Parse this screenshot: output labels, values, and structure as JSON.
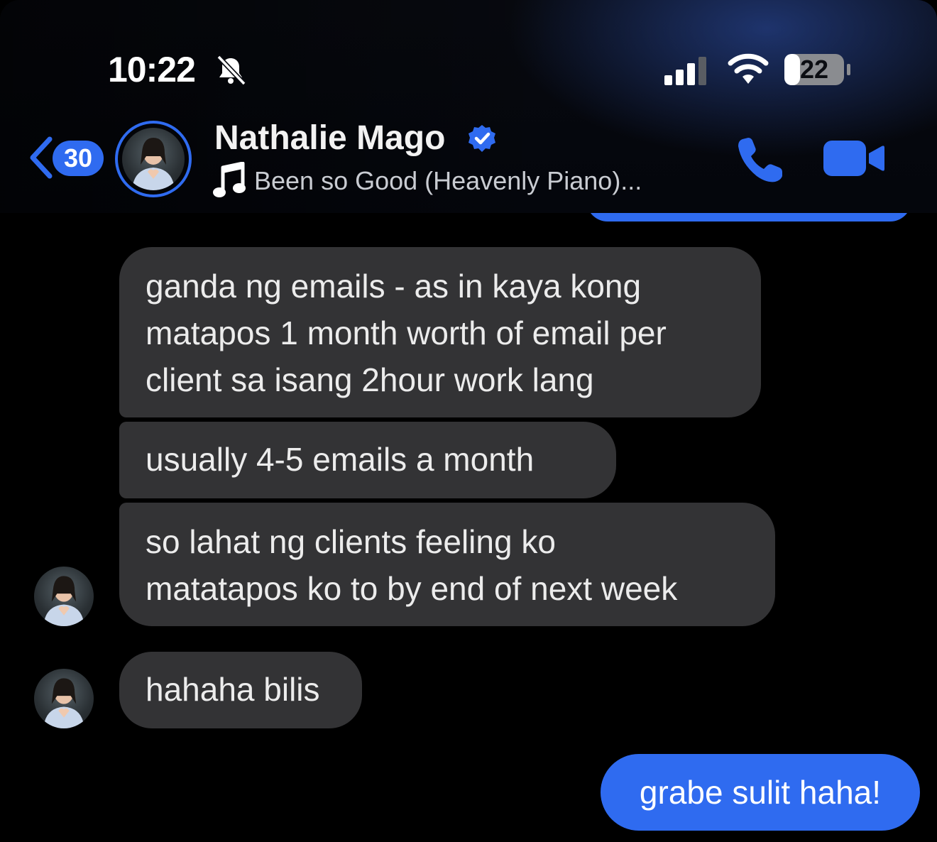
{
  "status_bar": {
    "time": "10:22",
    "battery": "22",
    "icons": [
      "bell-slash-icon",
      "cellular-signal-icon",
      "wifi-icon",
      "battery-icon"
    ]
  },
  "header": {
    "back_count": "30",
    "contact_name": "Nathalie Mago",
    "verified": true,
    "now_playing": "Been so Good (Heavenly Piano)...",
    "icons": [
      "back-chevron-icon",
      "verified-badge-icon",
      "music-note-icon",
      "phone-icon",
      "video-camera-icon"
    ]
  },
  "colors": {
    "accent": "#2f6bf0",
    "incoming_bubble": "#333335",
    "background": "#000000"
  },
  "messages": [
    {
      "direction": "incoming",
      "lines": [
        "ganda ng emails - as in kaya kong",
        "matapos 1 month worth of email per",
        "client sa isang 2hour work lang"
      ]
    },
    {
      "direction": "incoming",
      "lines": [
        "usually 4-5 emails a month"
      ]
    },
    {
      "direction": "incoming",
      "lines": [
        "so lahat ng clients feeling ko",
        "matatapos ko to by end of next week"
      ]
    },
    {
      "direction": "incoming",
      "lines": [
        "hahaha bilis"
      ]
    },
    {
      "direction": "outgoing",
      "lines": [
        "grabe sulit haha!"
      ]
    }
  ]
}
